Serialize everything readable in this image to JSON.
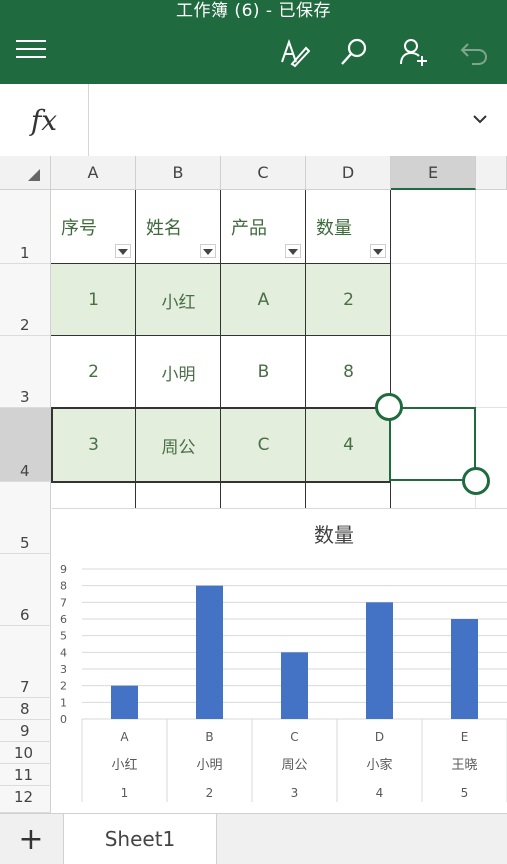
{
  "window": {
    "title": "工作簿 (6) - 已保存"
  },
  "toolbar": {
    "icons": [
      "menu-icon",
      "draw-pen-icon",
      "search-icon",
      "share-person-icon",
      "undo-icon"
    ],
    "accent": "#1f6b3f"
  },
  "formula_bar": {
    "fx_label": "fx",
    "value": ""
  },
  "columns": [
    "A",
    "B",
    "C",
    "D",
    "E"
  ],
  "rows": [
    "1",
    "2",
    "3",
    "4",
    "5",
    "6",
    "7",
    "8",
    "9",
    "10",
    "11",
    "12"
  ],
  "table": {
    "headers": [
      "序号",
      "姓名",
      "产品",
      "数量"
    ],
    "rows": [
      [
        "1",
        "小红",
        "A",
        "2"
      ],
      [
        "2",
        "小明",
        "B",
        "8"
      ],
      [
        "3",
        "周公",
        "C",
        "4"
      ]
    ],
    "band_color": "#e3efdc"
  },
  "selection": {
    "cell": "E4"
  },
  "chart_data": {
    "type": "bar",
    "title": "数量",
    "categories": [
      [
        "A",
        "小红",
        "1"
      ],
      [
        "B",
        "小明",
        "2"
      ],
      [
        "C",
        "周公",
        "3"
      ],
      [
        "D",
        "小家",
        "4"
      ],
      [
        "E",
        "王晓",
        "5"
      ]
    ],
    "series": [
      {
        "values": [
          2,
          8,
          4,
          7,
          6
        ]
      }
    ],
    "ylim": [
      0,
      9
    ],
    "yticks": [
      "0",
      "1",
      "2",
      "3",
      "4",
      "5",
      "6",
      "7",
      "8",
      "9"
    ],
    "grid": true,
    "bar_color": "#4472c4"
  },
  "sheets": {
    "add_label": "+",
    "active": "Sheet1"
  }
}
